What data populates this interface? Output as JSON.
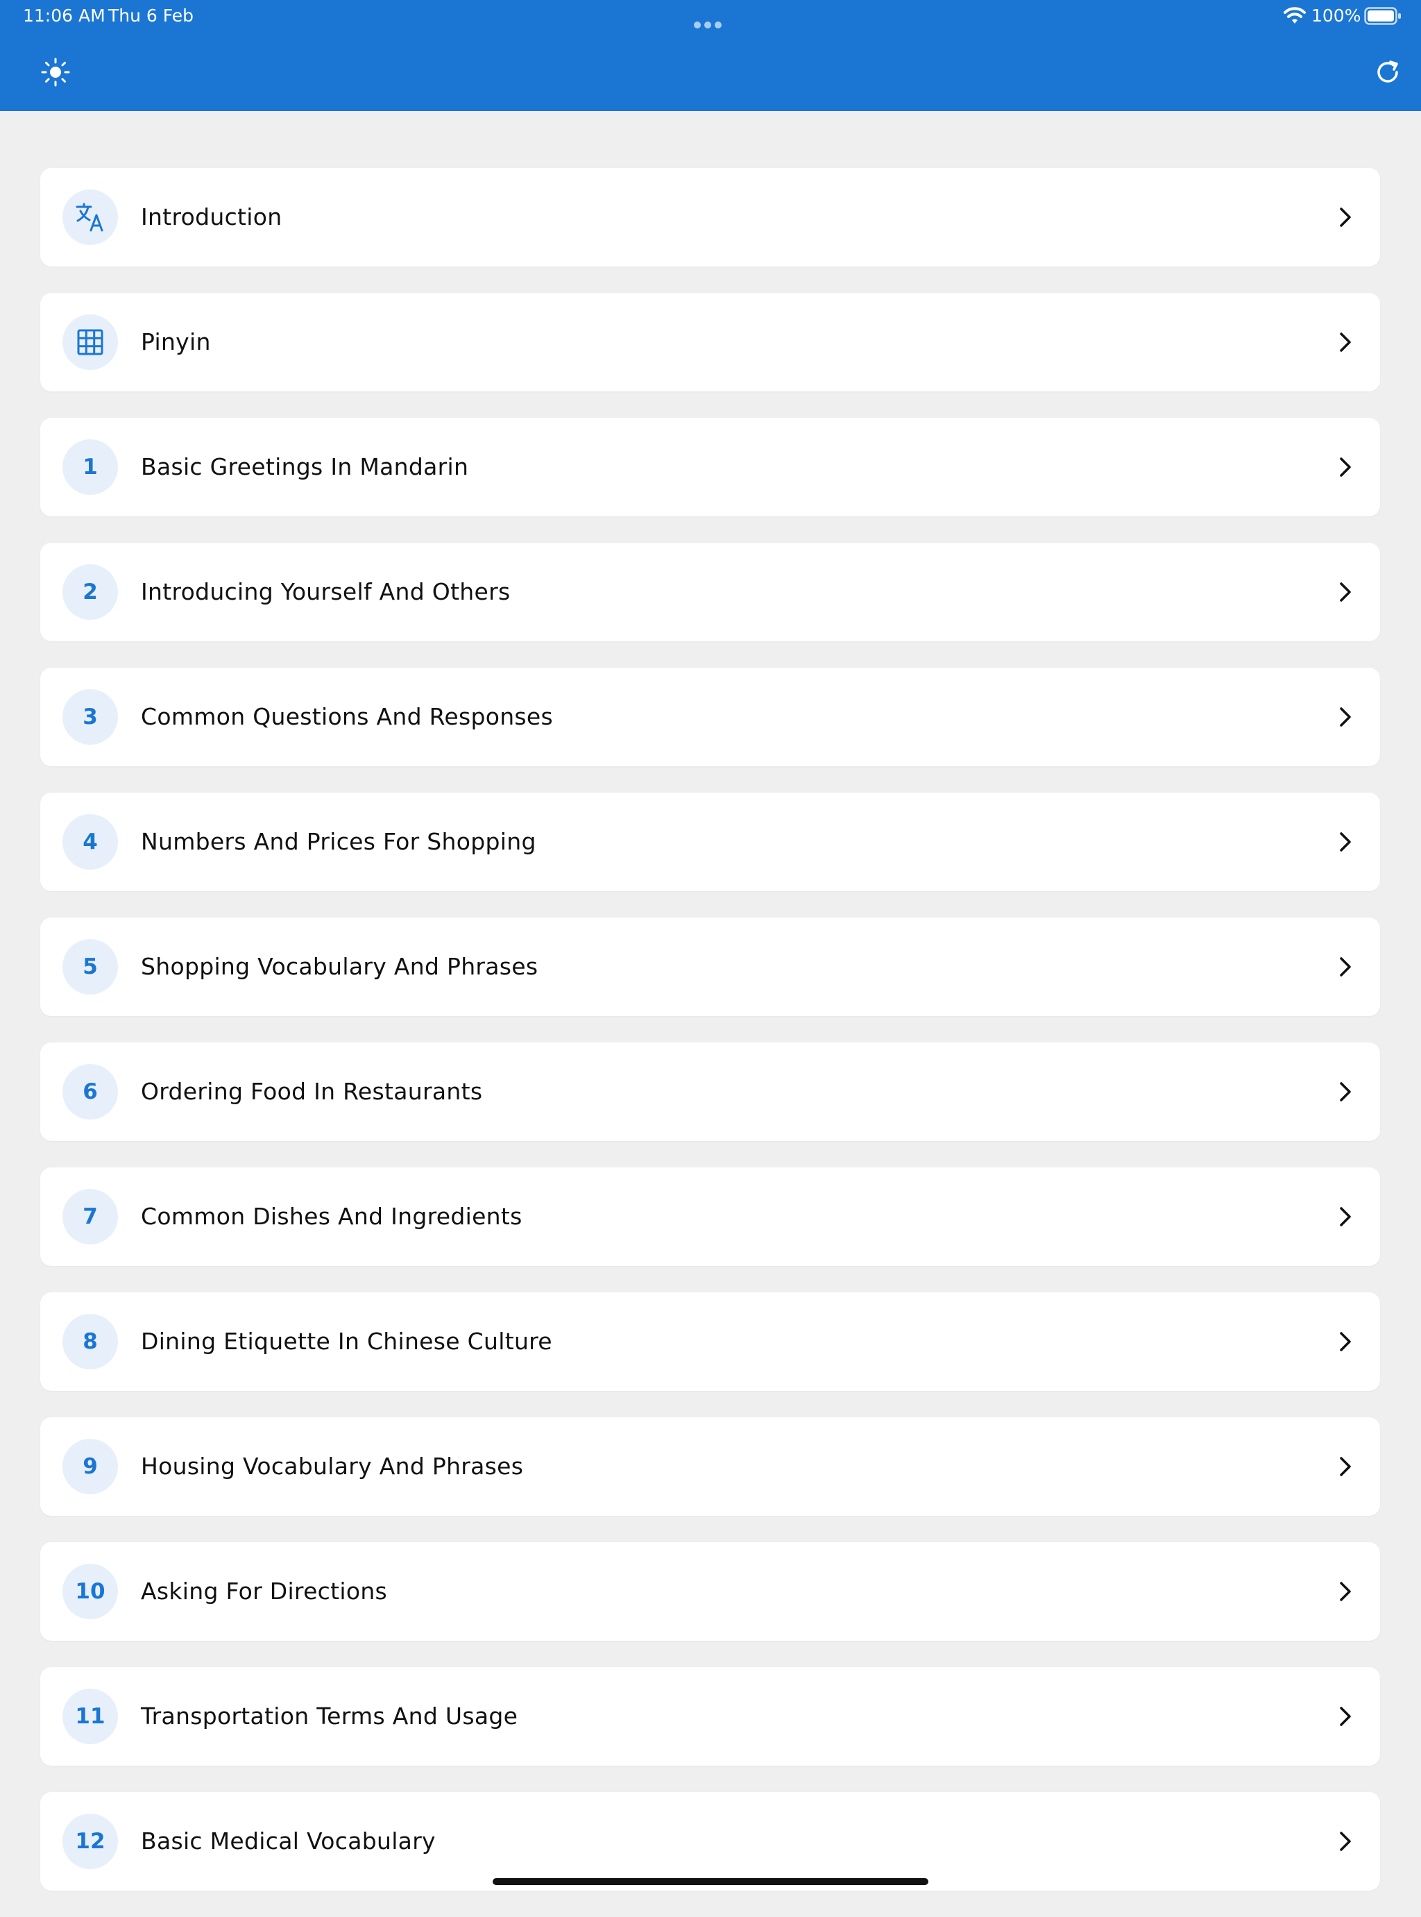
{
  "status_bar": {
    "time": "11:06 AM",
    "date": "Thu 6 Feb",
    "battery": "100%"
  },
  "header": {
    "left_icon": "sun-icon",
    "right_icon": "refresh-icon",
    "accent_color": "#1b76d3"
  },
  "lessons": [
    {
      "badge": "",
      "icon": "translate-icon",
      "label": "Introduction"
    },
    {
      "badge": "",
      "icon": "grid-icon",
      "label": "Pinyin"
    },
    {
      "badge": "1",
      "label": "Basic Greetings In Mandarin"
    },
    {
      "badge": "2",
      "label": "Introducing Yourself And Others"
    },
    {
      "badge": "3",
      "label": "Common Questions And Responses"
    },
    {
      "badge": "4",
      "label": "Numbers And Prices For Shopping"
    },
    {
      "badge": "5",
      "label": "Shopping Vocabulary And Phrases"
    },
    {
      "badge": "6",
      "label": "Ordering Food In Restaurants"
    },
    {
      "badge": "7",
      "label": "Common Dishes And Ingredients"
    },
    {
      "badge": "8",
      "label": "Dining Etiquette In Chinese Culture"
    },
    {
      "badge": "9",
      "label": "Housing Vocabulary And Phrases"
    },
    {
      "badge": "10",
      "label": "Asking For Directions"
    },
    {
      "badge": "11",
      "label": "Transportation Terms And Usage"
    },
    {
      "badge": "12",
      "label": "Basic Medical Vocabulary"
    }
  ]
}
